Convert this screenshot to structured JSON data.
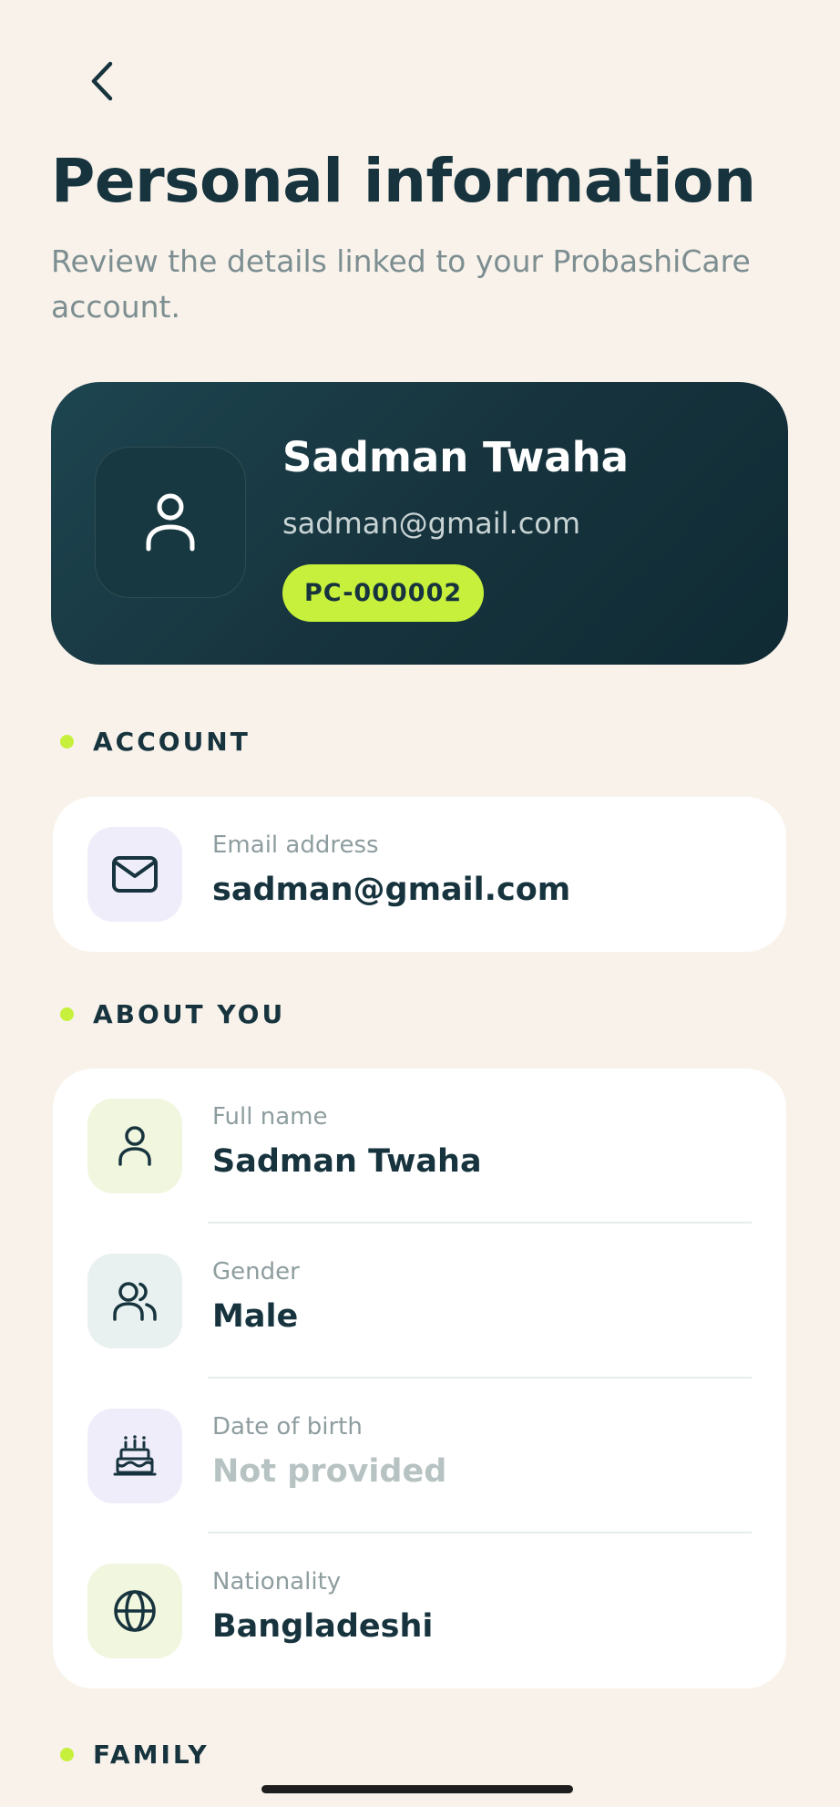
{
  "header": {
    "back_icon": "chevron-left-icon",
    "title": "Personal information",
    "subtitle": "Review the details linked to your ProbashiCare account."
  },
  "profile": {
    "avatar_icon": "user-icon",
    "name": "Sadman Twaha",
    "email": "sadman@gmail.com",
    "member_id": "PC-000002"
  },
  "sections": {
    "account": {
      "title": "ACCOUNT",
      "items": [
        {
          "label": "Email address",
          "value": "sadman@gmail.com",
          "icon": "mail-icon",
          "icon_bg": "#EFEDFA"
        }
      ]
    },
    "about_you": {
      "title": "ABOUT YOU",
      "items": [
        {
          "label": "Full name",
          "value": "Sadman Twaha",
          "icon": "user-icon",
          "icon_bg": "#F1F6DF"
        },
        {
          "label": "Gender",
          "value": "Male",
          "icon": "users-icon",
          "icon_bg": "#E8F1EF"
        },
        {
          "label": "Date of birth",
          "value": "Not provided",
          "icon": "cake-icon",
          "icon_bg": "#EFEDFA"
        },
        {
          "label": "Nationality",
          "value": "Bangladeshi",
          "icon": "globe-icon",
          "icon_bg": "#F1F6DF"
        }
      ]
    },
    "family": {
      "title": "FAMILY"
    }
  },
  "colors": {
    "background": "#F8F2EB",
    "primary_dark": "#17343E",
    "accent_lime": "#C6F03B",
    "muted_text": "#8E9D9F"
  }
}
